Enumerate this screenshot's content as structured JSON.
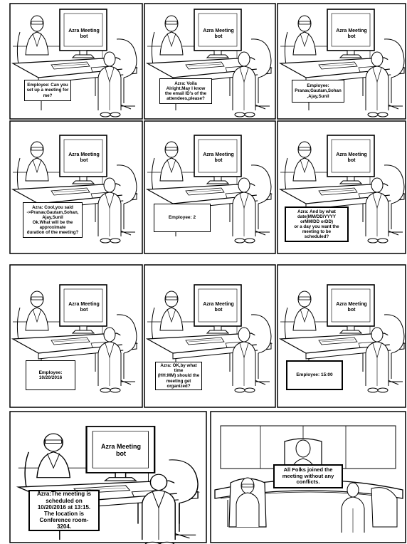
{
  "panels": [
    {
      "screen": "Azra Meeting\nbot",
      "caption": "Employee: Can you\nset up a meeting for\nme?"
    },
    {
      "screen": "Azra Meeting\nbot",
      "caption": "Azra: Voila\nAlright.May I know\nthe email ID's of the\nattendees,please?"
    },
    {
      "screen": "Azra Meeting\nbot",
      "caption": "Employee:\nPranav,Gautam,Sohan\n,Ajay,Sunil"
    },
    {
      "screen": "Azra Meeting\nbot",
      "caption": "Azra: Cool,you said\n->Pranav,Gautam,Sohan,\nAjay,Sunil\nOk.What will be the\napproximate\nduration of the meeting?"
    },
    {
      "screen": "Azra Meeting\nbot",
      "caption": "Employee: 2"
    },
    {
      "screen": "Azra Meeting\nbot",
      "caption": "Azra: And by what\ndate(MM/DD/YYYY\norMM/DD orDD)\nor a day you want the\nmeeting to be\nscheduled?"
    },
    {
      "screen": "Azra Meeting\nbot",
      "caption": "Employee:\n10/20/2016"
    },
    {
      "screen": "Azra Meeting\nbot",
      "caption": "Azra: OK,by what time\n(HH:MM) should the\nmeeting get\norganized?"
    },
    {
      "screen": "Azra Meeting\nbot",
      "caption": "Employee: 15:00"
    },
    {
      "screen": "Azra Meeting\nbot",
      "caption": "Azra:The meeting is\nscheduled on\n10/20/2016 at 13:15.\nThe location is\nConference room-\n3204."
    },
    {
      "caption": "All Folks joined the\nmeeting without any\nconflicts."
    }
  ]
}
